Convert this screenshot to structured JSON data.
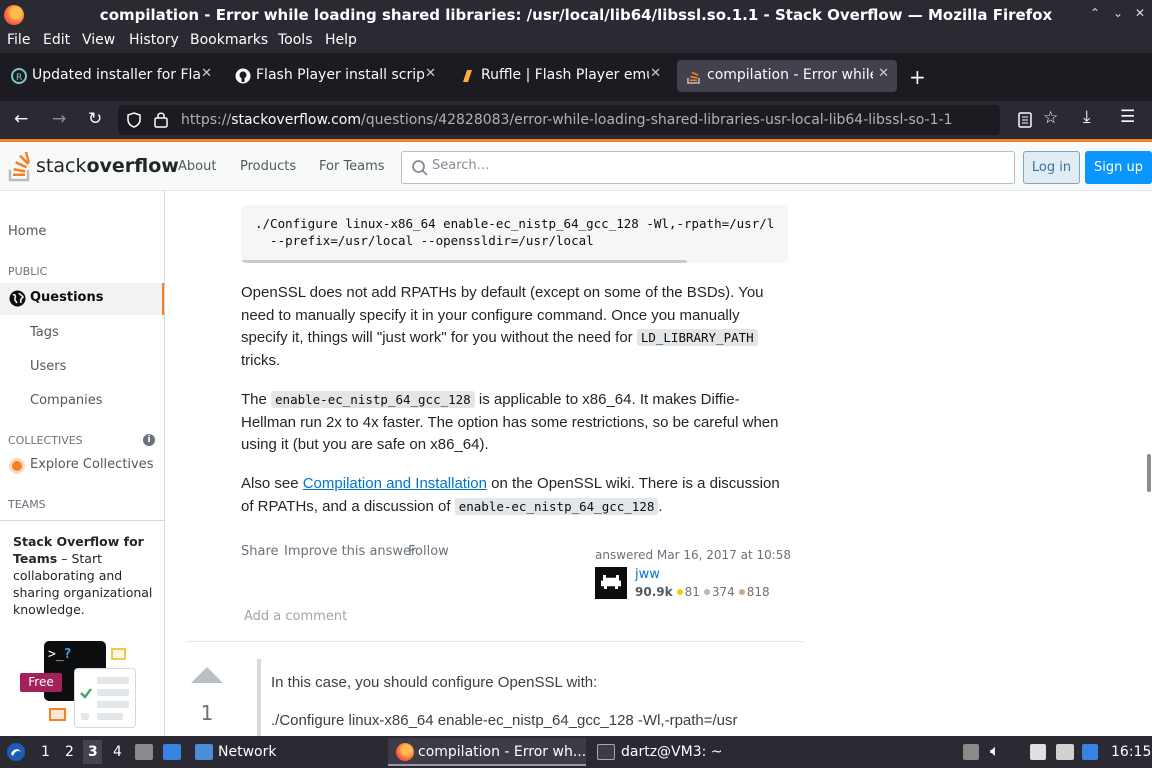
{
  "window": {
    "title": "compilation - Error while loading shared libraries: /usr/local/lib64/libssl.so.1.1 - Stack Overflow — Mozilla Firefox",
    "controls": [
      "⌃",
      "⌄",
      "✕"
    ]
  },
  "menu": [
    "File",
    "Edit",
    "View",
    "History",
    "Bookmarks",
    "Tools",
    "Help"
  ],
  "tabs": [
    {
      "label": "Updated installer for Flas"
    },
    {
      "label": "Flash Player install script"
    },
    {
      "label": "Ruffle | Flash Player emu"
    },
    {
      "label": "compilation - Error while"
    }
  ],
  "nav": {
    "url_prefix": "https://",
    "url_domain": "stackoverflow.com",
    "url_path": "/questions/42828083/error-while-loading-shared-libraries-usr-local-lib64-libssl-so-1-1"
  },
  "so_header": {
    "logo_text_1": "stack",
    "logo_text_2": "overflow",
    "nav": [
      "About",
      "Products",
      "For Teams"
    ],
    "search_placeholder": "Search…",
    "login": "Log in",
    "signup": "Sign up"
  },
  "sidebar": {
    "home": "Home",
    "public_heading": "PUBLIC",
    "questions": "Questions",
    "tags": "Tags",
    "users": "Users",
    "companies": "Companies",
    "collectives_heading": "COLLECTIVES",
    "explore_collectives": "Explore Collectives",
    "teams_heading": "TEAMS",
    "teams_title": "Stack Overflow for Teams",
    "teams_desc": "– Start collaborating and sharing organizational knowledge.",
    "free_badge": "Free",
    "terminal_text": ">_",
    "terminal_q": "?"
  },
  "answer": {
    "code_line_1": "./Configure linux-x86_64 enable-ec_nistp_64_gcc_128 -Wl,-rpath=/usr/l",
    "code_line_2": "  --prefix=/usr/local --openssldir=/usr/local",
    "p1_a": "OpenSSL does not add RPATHs by default (except on some of the BSDs). You need to manually specify it in your configure command. Once you manually specify it, things will \"just work\" for you without the need for",
    "p1_code": "LD_LIBRARY_PATH",
    "p1_b": "tricks.",
    "p2_a": "The",
    "p2_code": "enable-ec_nistp_64_gcc_128",
    "p2_b": "is applicable to x86_64. It makes Diffie-Hellman run 2x to 4x faster. The option has some restrictions, so be careful when using it (but you are safe on x86_64).",
    "p3_a": "Also see",
    "p3_link": "Compilation and Installation",
    "p3_b": "on the OpenSSL wiki. There is a discussion of RPATHs, and a discussion of",
    "p3_code": "enable-ec_nistp_64_gcc_128",
    "p3_c": ".",
    "share": "Share",
    "improve": "Improve this answer",
    "follow": "Follow",
    "answered": "answered Mar 16, 2017 at 10:58",
    "user": "jww",
    "rep": "90.9k",
    "gold": "81",
    "silver": "374",
    "bronze": "818",
    "add_comment": "Add a comment"
  },
  "next_answer": {
    "votes": "1",
    "line1": "In this case, you should configure OpenSSL with:",
    "line2": "./Configure linux-x86_64 enable-ec_nistp_64_gcc_128 -Wl,-rpath=/usr"
  },
  "taskbar": {
    "workspaces": [
      "1",
      "2",
      "3",
      "4"
    ],
    "active_workspace": "3",
    "network": "Network",
    "firefox_task": "compilation - Error wh...",
    "terminal_task": "dartz@VM3: ~",
    "clock": "16:15"
  },
  "colors": {
    "so_orange": "#f48225",
    "so_blue": "#0a95ff",
    "firefox_dark": "#2b2a33",
    "gold": "#ffcc01",
    "silver": "#b4b8bc",
    "bronze": "#d1a684"
  }
}
